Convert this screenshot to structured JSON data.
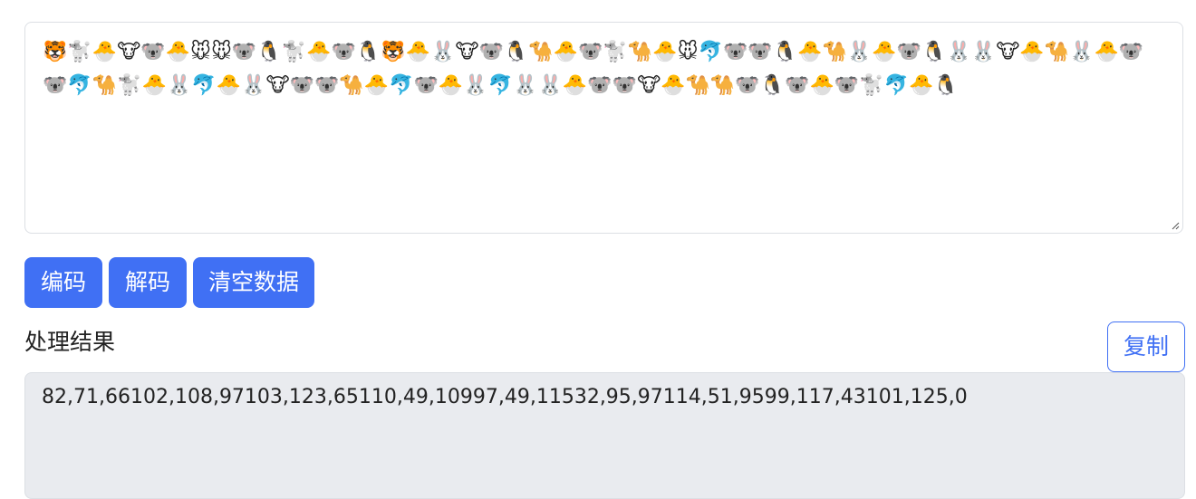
{
  "input": {
    "emoji_text": "🐯🐩🐣🐮🐨🐣🐭🐭🐨🐧🐩🐣🐨🐧🐯🐣🐰🐮🐨🐧🐪🐣🐨🐩🐪🐣🐭🐬🐨🐨🐧🐣🐪🐰🐣🐨🐧🐰🐰🐮🐣🐪🐰🐣🐨🐨🐬🐪🐩🐣🐰🐬🐣🐰🐮🐨🐨🐪🐣🐬🐨🐣🐰🐬🐰🐰🐣🐨🐨🐮🐣🐪🐪🐨🐧🐨🐣🐨🐩🐬🐣🐧"
  },
  "buttons": {
    "encode": "编码",
    "decode": "解码",
    "clear": "清空数据",
    "copy": "复制"
  },
  "result": {
    "label": "处理结果",
    "value": "82,71,66102,108,97103,123,65110,49,10997,49,11532,95,97114,51,9599,117,43101,125,0"
  },
  "colors": {
    "primary": "#4070f4",
    "output_bg": "#e9ebef",
    "border": "#dcdfe4"
  }
}
